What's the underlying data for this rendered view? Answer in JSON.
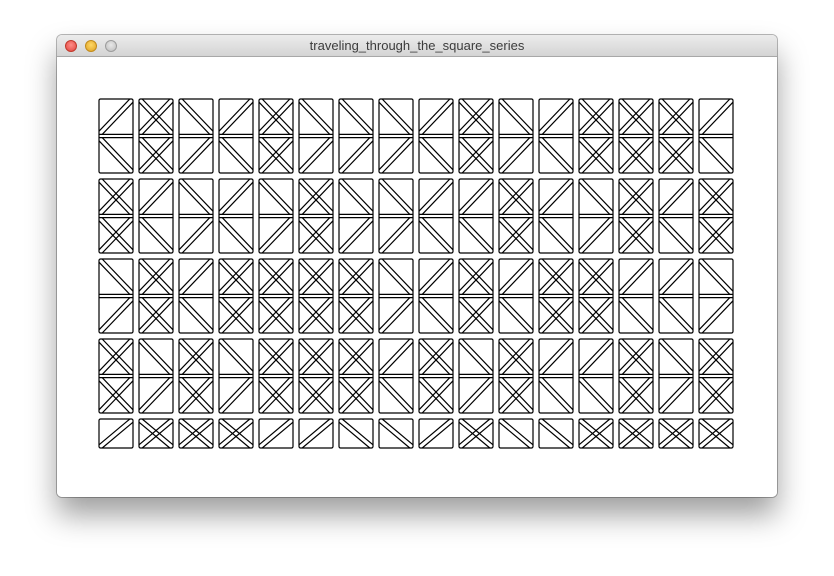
{
  "window": {
    "title": "traveling_through_the_square_series",
    "buttons": [
      "close",
      "minimize",
      "zoom"
    ]
  },
  "artwork": {
    "description": "grid of squares, each split by diagonal pieces",
    "columns": 16,
    "rows": 5,
    "stroke_color": "#000000",
    "background_color": "#ffffff",
    "patterns": [
      [
        "/",
        "X",
        "\\",
        "/",
        "X",
        "\\",
        "\\",
        "\\",
        "/",
        "X",
        "\\",
        "/",
        "X",
        "X",
        "X",
        "/"
      ],
      [
        "X",
        "/",
        "\\",
        "/",
        "\\",
        "X",
        "\\",
        "\\",
        "/",
        "/",
        "X",
        "/",
        "\\",
        "X",
        "/",
        "X"
      ],
      [
        "\\",
        "X",
        "/",
        "X",
        "X",
        "X",
        "X",
        "\\",
        "/",
        "X",
        "/",
        "X",
        "X",
        "/",
        "/",
        "\\"
      ],
      [
        "X",
        "\\",
        "X",
        "\\",
        "X",
        "X",
        "X",
        "/",
        "X",
        "\\",
        "X",
        "/",
        "/",
        "X",
        "\\",
        "X"
      ],
      [
        "/",
        "X",
        "X",
        "X",
        "/",
        "/",
        "\\",
        "\\",
        "/",
        "X",
        "\\",
        "\\",
        "X",
        "X",
        "X",
        "X"
      ]
    ]
  }
}
